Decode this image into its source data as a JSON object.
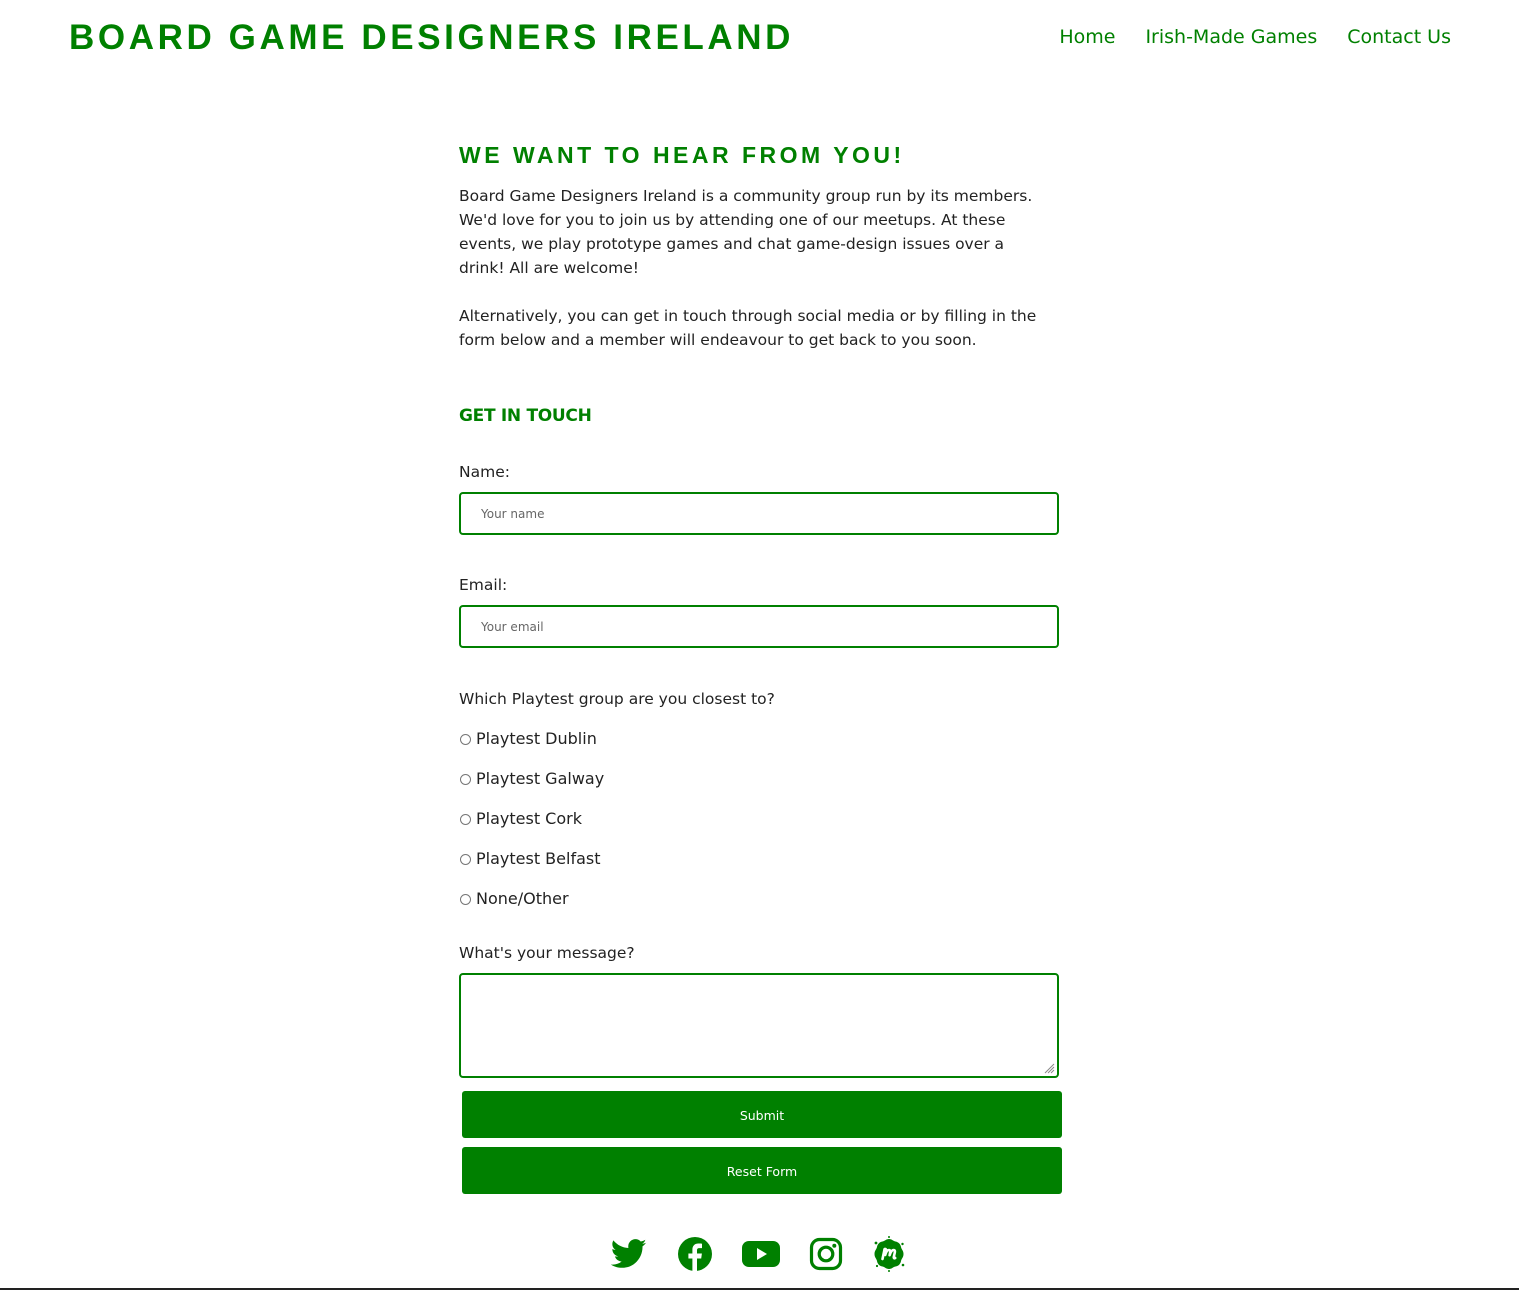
{
  "site": {
    "title": "BOARD GAME DESIGNERS IRELAND",
    "brand_color": "#008000"
  },
  "nav": {
    "items": [
      {
        "label": "Home"
      },
      {
        "label": "Irish-Made Games"
      },
      {
        "label": "Contact Us"
      }
    ]
  },
  "main": {
    "heading": "WE WANT TO HEAR FROM YOU!",
    "paragraphs": [
      "Board Game Designers Ireland is a community group run by its members. We'd love for you to join us by attending one of our meetups. At these events, we play prototype games and chat game-design issues over a drink! All are welcome!",
      "Alternatively, you can get in touch through social media or by filling in the form below and a member will endeavour to get back to you soon."
    ]
  },
  "form": {
    "heading": "GET IN TOUCH",
    "name_label": "Name:",
    "name_placeholder": "Your name",
    "name_value": "",
    "email_label": "Email:",
    "email_placeholder": "Your email",
    "email_value": "",
    "group_question": "Which Playtest group are you closest to?",
    "groups": [
      {
        "label": "Playtest Dublin",
        "checked": false
      },
      {
        "label": "Playtest Galway",
        "checked": false
      },
      {
        "label": "Playtest Cork",
        "checked": false
      },
      {
        "label": "Playtest Belfast",
        "checked": false
      },
      {
        "label": "None/Other",
        "checked": false
      }
    ],
    "message_label": "What's your message?",
    "message_value": "",
    "submit_label": "Submit",
    "reset_label": "Reset Form"
  },
  "social": [
    {
      "icon": "twitter-icon"
    },
    {
      "icon": "facebook-icon"
    },
    {
      "icon": "youtube-icon"
    },
    {
      "icon": "instagram-icon"
    },
    {
      "icon": "meetup-icon"
    }
  ]
}
